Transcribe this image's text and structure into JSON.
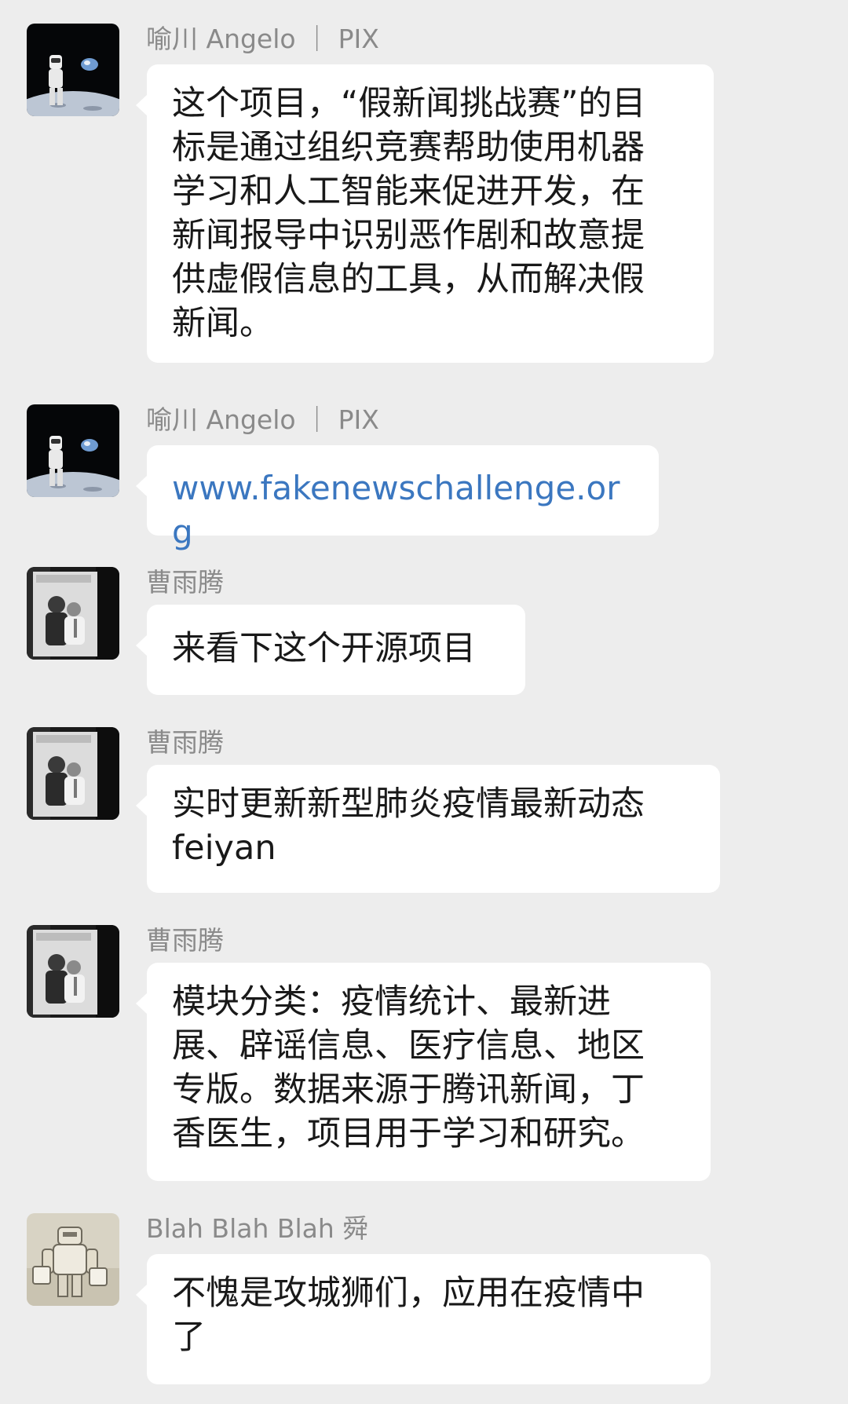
{
  "messages": [
    {
      "sender": "喻川 Angelo ｜ PIX",
      "avatar": "astronaut-moon-avatar",
      "text": "这个项目，“假新闻挑战赛”的目\n标是通过组织竞赛帮助使用机器\n学习和人工智能来促进开发，在\n新闻报导中识别恶作剧和故意提\n供虚假信息的工具，从而解决假\n新闻。",
      "is_link": false
    },
    {
      "sender": "喻川 Angelo ｜ PIX",
      "avatar": "astronaut-moon-avatar",
      "text": "www.fakenewschallenge.org",
      "is_link": true
    },
    {
      "sender": "曹雨腾",
      "avatar": "photo-avatar",
      "text": "来看下这个开源项目",
      "is_link": false
    },
    {
      "sender": "曹雨腾",
      "avatar": "photo-avatar",
      "text": "实时更新新型肺炎疫情最新动态\nfeiyan",
      "is_link": false
    },
    {
      "sender": "曹雨腾",
      "avatar": "photo-avatar",
      "text": "模块分类：疫情统计、最新进\n展、辟谣信息、医疗信息、地区\n专版。数据来源于腾讯新闻，丁\n香医生，项目用于学习和研究。",
      "is_link": false
    },
    {
      "sender": "Blah Blah Blah 舜",
      "avatar": "robot-sketch-avatar",
      "text": "不愧是攻城狮们，应用在疫情中\n了",
      "is_link": false
    }
  ]
}
